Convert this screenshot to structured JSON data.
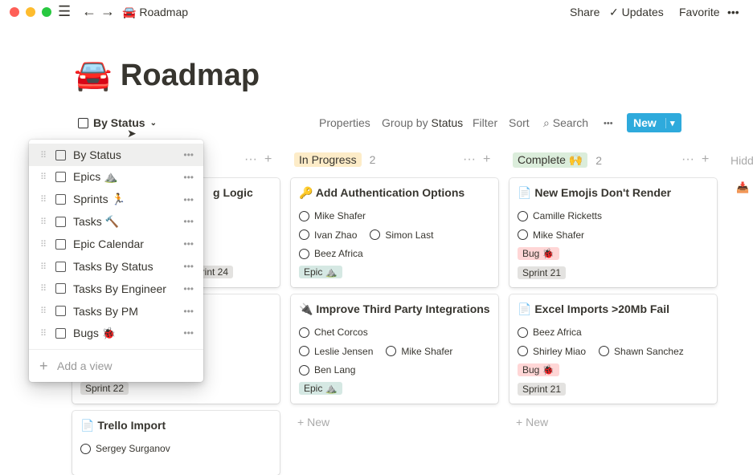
{
  "window": {
    "title": "Roadmap",
    "title_emoji": "🚘",
    "share": "Share",
    "updates": "Updates",
    "favorite": "Favorite",
    "more": "•••"
  },
  "page": {
    "title": "Roadmap",
    "emoji": "🚘"
  },
  "view": {
    "current": "By Status"
  },
  "toolbar": {
    "properties": "Properties",
    "group_by_prefix": "Group by",
    "group_by_value": "Status",
    "filter": "Filter",
    "sort": "Sort",
    "search": "Search",
    "more": "•••",
    "new": "New"
  },
  "menu": {
    "items": [
      {
        "label": "By Status",
        "icon": "board-icon"
      },
      {
        "label": "Epics ⛰️",
        "icon": "table-icon"
      },
      {
        "label": "Sprints 🏃",
        "icon": "board-icon"
      },
      {
        "label": "Tasks 🔨",
        "icon": "table-icon"
      },
      {
        "label": "Epic Calendar",
        "icon": "calendar-icon"
      },
      {
        "label": "Tasks By Status",
        "icon": "board-icon"
      },
      {
        "label": "Tasks By Engineer",
        "icon": "board-icon"
      },
      {
        "label": "Tasks By PM",
        "icon": "board-icon"
      },
      {
        "label": "Bugs 🐞",
        "icon": "table-icon"
      }
    ],
    "add": "Add a view",
    "more": "•••"
  },
  "columns": [
    {
      "cards": [
        {
          "title": "g Logic",
          "tags": [
            "Sprint 24"
          ]
        },
        {
          "tags": [
            "Sprint 22"
          ]
        },
        {
          "title": "Trello Import",
          "people": [
            "Sergey Surganov"
          ]
        }
      ]
    },
    {
      "label": "In Progress",
      "count": "2",
      "color": "#fdecc8",
      "cards": [
        {
          "icon": "🔑",
          "title": "Add Authentication Options",
          "rows": [
            [
              "Mike Shafer"
            ],
            [
              "Ivan Zhao",
              "Simon Last"
            ],
            [
              "Beez Africa"
            ]
          ],
          "tags": [
            {
              "t": "Epic ⛰️",
              "c": "epic"
            }
          ]
        },
        {
          "icon": "🔌",
          "title": "Improve Third Party Integrations",
          "rows": [
            [
              "Chet Corcos"
            ],
            [
              "Leslie Jensen",
              "Mike Shafer"
            ],
            [
              "Ben Lang"
            ]
          ],
          "tags": [
            {
              "t": "Epic ⛰️",
              "c": "epic"
            }
          ]
        }
      ],
      "new": "New"
    },
    {
      "label": "Complete 🙌",
      "count": "2",
      "color": "#dbeddb",
      "cards": [
        {
          "icon": "📄",
          "title": "New Emojis Don't Render",
          "rows": [
            [
              "Camille Ricketts"
            ],
            [
              "Mike Shafer"
            ]
          ],
          "tags": [
            {
              "t": "Bug 🐞",
              "c": "bug"
            },
            {
              "t": "Sprint 21",
              "c": "sprint"
            }
          ]
        },
        {
          "icon": "📄",
          "title": "Excel Imports >20Mb Fail",
          "rows": [
            [
              "Beez Africa"
            ],
            [
              "Shirley Miao",
              "Shawn Sanchez"
            ]
          ],
          "tags": [
            {
              "t": "Bug 🐞",
              "c": "bug"
            },
            {
              "t": "Sprint 21",
              "c": "sprint"
            }
          ]
        }
      ],
      "new": "New"
    }
  ],
  "hidden": {
    "label": "Hidd"
  }
}
